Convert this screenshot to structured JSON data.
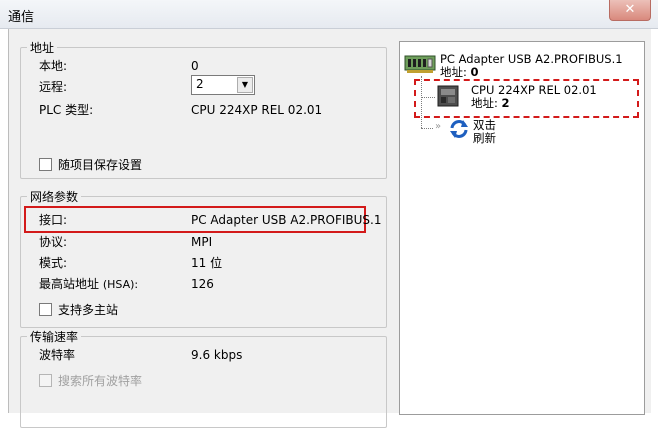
{
  "window": {
    "title": "通信",
    "close_glyph": "✕"
  },
  "address": {
    "legend": "地址",
    "local_label": "本地:",
    "local_value": "0",
    "remote_label": "远程:",
    "remote_value": "2",
    "plc_type_label": "PLC 类型:",
    "plc_type_value": "CPU 224XP REL 02.01",
    "save_with_project": {
      "label": "随项目保存设置",
      "checked": false
    }
  },
  "network": {
    "legend": "网络参数",
    "interface_label": "接口:",
    "interface_value": "PC Adapter USB A2.PROFIBUS.1",
    "protocol_label": "协议:",
    "protocol_value": "MPI",
    "mode_label": "模式:",
    "mode_value": "11 位",
    "hsa_label": "最高站地址",
    "hsa_suffix": "(HSA):",
    "hsa_value": "126",
    "multi_master": {
      "label": "支持多主站",
      "checked": false
    }
  },
  "baud": {
    "legend": "传输速率",
    "rate_label": "波特率",
    "rate_value": "9.6 kbps",
    "search_all": {
      "label": "搜索所有波特率",
      "checked": false,
      "disabled": true
    }
  },
  "tree": {
    "adapter_name": "PC Adapter USB A2.PROFIBUS.1",
    "adapter_address_label": "地址:",
    "adapter_address_value": "0",
    "cpu_name": "CPU 224XP REL 02.01",
    "cpu_address_label": "地址:",
    "cpu_address_value": "2",
    "refresh_line1": "双击",
    "refresh_line2": "刷新"
  },
  "colors": {
    "highlight_red": "#d31a1a",
    "refresh_blue": "#1e5fbf"
  }
}
